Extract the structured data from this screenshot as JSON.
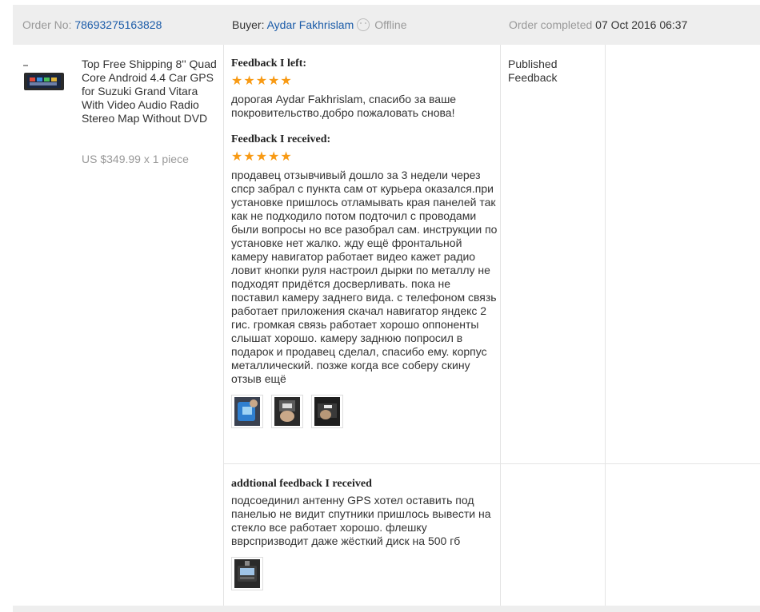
{
  "order": {
    "order_no_label": "Order No:",
    "order_no": "78693275163828",
    "buyer_label": "Buyer:",
    "buyer_name": "Aydar Fakhrislam",
    "buyer_status": "Offline",
    "completed_label": "Order completed",
    "completed_date": "07 Oct 2016 06:37"
  },
  "product": {
    "title": "Top Free Shipping 8'' Quad Core Android 4.4 Car GPS for Suzuki Grand Vitara With Video Audio Radio Stereo Map Without DVD",
    "price": "US $349.99 x 1 piece"
  },
  "feedback_left": {
    "label": "Feedback I left:",
    "stars": 5,
    "text": "дорогая Aydar Fakhrislam, спасибо за ваше покровительство.добро пожаловать снова!"
  },
  "feedback_received": {
    "label": "Feedback I received:",
    "stars": 5,
    "text": "продавец отзывчивый дошло за 3 недели через спср забрал с пункта сам от курьера оказался.при установке пришлось отламывать края панелей так как не подходило потом подточил с проводами были вопросы но все разобрал сам. инструкции по установке нет жалко. жду ещё фронтальной камеру навигатор работает видео кажет радио ловит кнопки руля настроил дырки по металлу не подходят придётся досверливать. пока не поставил камеру заднего вида. с телефоном связь работает приложения скачал навигатор яндекс 2 гис. громкая связь работает хорошо оппоненты слышат хорошо. камеру заднюю попросил в подарок и продавец сделал, спасибо ему. корпус металлический. позже когда все соберу скину отзыв ещё",
    "photo_count": 3
  },
  "additional_feedback": {
    "label": "addtional feedback I received",
    "text": "подсоединил антенну GPS хотел оставить под панелью не видит спутники пришлось вывести на стекло все работает хорошо. флешку ввpспризводит даже жёсткий диск на 500 гб",
    "photo_count": 1
  },
  "status": {
    "text": "Published Feedback"
  },
  "colors": {
    "link": "#1a5ba8",
    "star": "#f89a14",
    "header_bg": "#eeeeee"
  }
}
